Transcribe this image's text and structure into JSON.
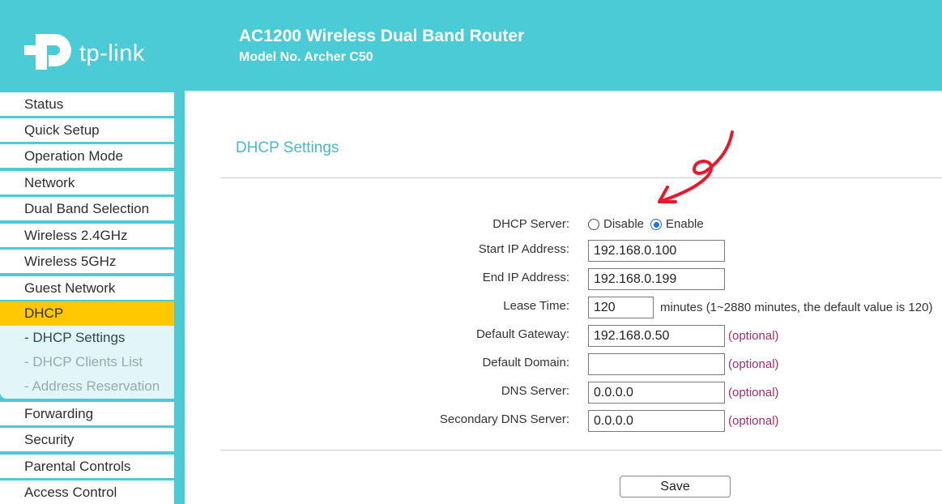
{
  "header": {
    "logo_text": "tp-link",
    "title": "AC1200 Wireless Dual Band Router",
    "model": "Model No. Archer C50",
    "background_color": "#4acbd6"
  },
  "sidebar": {
    "items": [
      {
        "label": "Status"
      },
      {
        "label": "Quick Setup"
      },
      {
        "label": "Operation Mode"
      },
      {
        "label": "Network"
      },
      {
        "label": "Dual Band Selection"
      },
      {
        "label": "Wireless 2.4GHz"
      },
      {
        "label": "Wireless 5GHz"
      },
      {
        "label": "Guest Network"
      },
      {
        "label": "DHCP",
        "active": true
      },
      {
        "label": "Forwarding"
      },
      {
        "label": "Security"
      },
      {
        "label": "Parental Controls"
      },
      {
        "label": "Access Control"
      }
    ],
    "dhcp_submenu": [
      {
        "label": "- DHCP Settings",
        "current": true
      },
      {
        "label": "- DHCP Clients List"
      },
      {
        "label": "- Address Reservation"
      }
    ],
    "active_color": "#ffc800"
  },
  "main": {
    "title": "DHCP Settings",
    "dhcp_server": {
      "label": "DHCP Server:",
      "options": [
        "Disable",
        "Enable"
      ],
      "selected": "Enable"
    },
    "fields": {
      "start_ip": {
        "label": "Start IP Address:",
        "value": "192.168.0.100"
      },
      "end_ip": {
        "label": "End IP Address:",
        "value": "192.168.0.199"
      },
      "lease_time": {
        "label": "Lease Time:",
        "value": "120",
        "hint": "minutes (1~2880 minutes, the default value is 120)"
      },
      "default_gateway": {
        "label": "Default Gateway:",
        "value": "192.168.0.50",
        "note": "(optional)"
      },
      "default_domain": {
        "label": "Default Domain:",
        "value": "",
        "note": "(optional)"
      },
      "dns_server": {
        "label": "DNS Server:",
        "value": "0.0.0.0",
        "note": "(optional)"
      },
      "secondary_dns": {
        "label": "Secondary DNS Server:",
        "value": "0.0.0.0",
        "note": "(optional)"
      }
    },
    "save_label": "Save",
    "title_color": "#4ab8c9",
    "optional_color": "#a0306a"
  },
  "annotation": {
    "icon": "red-arrow-annotation-icon",
    "color": "#e8192c"
  }
}
